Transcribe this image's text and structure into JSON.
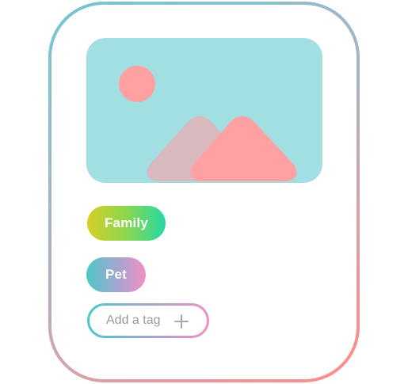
{
  "image": {
    "icon": "image-placeholder-icon",
    "colors": {
      "background": "#a1dfe3",
      "sun": "#ffa1a2",
      "mountain_back": "#d8b9be",
      "mountain_front": "#ffa1a2"
    }
  },
  "tags": [
    {
      "label": "Family"
    },
    {
      "label": "Pet"
    }
  ],
  "add_tag": {
    "placeholder": "Add a tag",
    "icon": "plus-icon"
  }
}
